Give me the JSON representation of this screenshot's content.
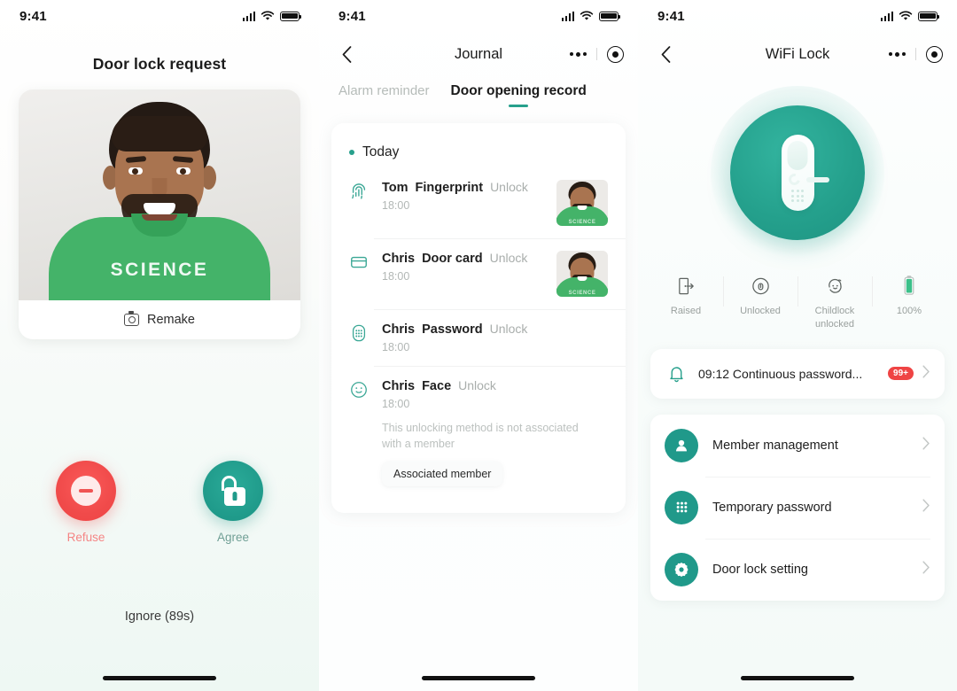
{
  "status_bar": {
    "time": "9:41",
    "signal_icon": "cellular-signal-icon",
    "wifi_icon": "wifi-icon",
    "battery_icon": "battery-full-icon"
  },
  "colors": {
    "accent_green": "#20998a",
    "accent_green_light": "#27a08c",
    "danger_red": "#ef4444",
    "badge_red": "#ef4444",
    "shirt_green": "#44b369"
  },
  "panel_request": {
    "title": "Door lock request",
    "photo_shirt_text": "SCIENCE",
    "remake_label": "Remake",
    "remake_icon": "camera-icon",
    "refuse_label": "Refuse",
    "refuse_icon": "minus-circle-icon",
    "agree_label": "Agree",
    "agree_icon": "unlock-icon",
    "ignore_label": "Ignore (89s)"
  },
  "panel_journal": {
    "nav": {
      "back_icon": "chevron-left-icon",
      "title": "Journal",
      "more_icon": "more-dots-icon",
      "target_icon": "target-icon"
    },
    "tabs": [
      {
        "label": "Alarm reminder",
        "active": false
      },
      {
        "label": "Door opening record",
        "active": true
      }
    ],
    "section_label": "Today",
    "entries": [
      {
        "icon": "fingerprint-icon",
        "name": "Tom",
        "method": "Fingerprint",
        "action": "Unlock",
        "time": "18:00",
        "has_thumb": true,
        "thumb_text": "SCIENCE"
      },
      {
        "icon": "door-card-icon",
        "name": "Chris",
        "method": "Door card",
        "action": "Unlock",
        "time": "18:00",
        "has_thumb": true,
        "thumb_text": "SCIENCE"
      },
      {
        "icon": "keypad-icon",
        "name": "Chris",
        "method": "Password",
        "action": "Unlock",
        "time": "18:00",
        "has_thumb": false
      },
      {
        "icon": "face-icon",
        "name": "Chris",
        "method": "Face",
        "action": "Unlock",
        "time": "18:00",
        "has_thumb": false,
        "note": "This unlocking method is not associated with a member",
        "chip": "Associated member"
      }
    ]
  },
  "panel_lock": {
    "nav": {
      "back_icon": "chevron-left-icon",
      "title": "WiFi Lock",
      "more_icon": "more-dots-icon",
      "target_icon": "target-icon"
    },
    "hero_icon": "smart-door-lock-icon",
    "stats": [
      {
        "icon": "door-raised-icon",
        "label": "Raised"
      },
      {
        "icon": "unlocked-icon",
        "label": "Unlocked"
      },
      {
        "icon": "childlock-icon",
        "label": "Childlock unlocked"
      },
      {
        "icon": "battery-icon",
        "label": "100%"
      }
    ],
    "alert": {
      "icon": "bell-icon",
      "text": "09:12 Continuous password...",
      "badge": "99+",
      "chevron_icon": "chevron-right-icon"
    },
    "menu": [
      {
        "icon": "person-icon",
        "label": "Member management",
        "chevron_icon": "chevron-right-icon"
      },
      {
        "icon": "keypad-grid-icon",
        "label": "Temporary password",
        "chevron_icon": "chevron-right-icon"
      },
      {
        "icon": "gear-icon",
        "label": "Door lock setting",
        "chevron_icon": "chevron-right-icon"
      }
    ]
  }
}
